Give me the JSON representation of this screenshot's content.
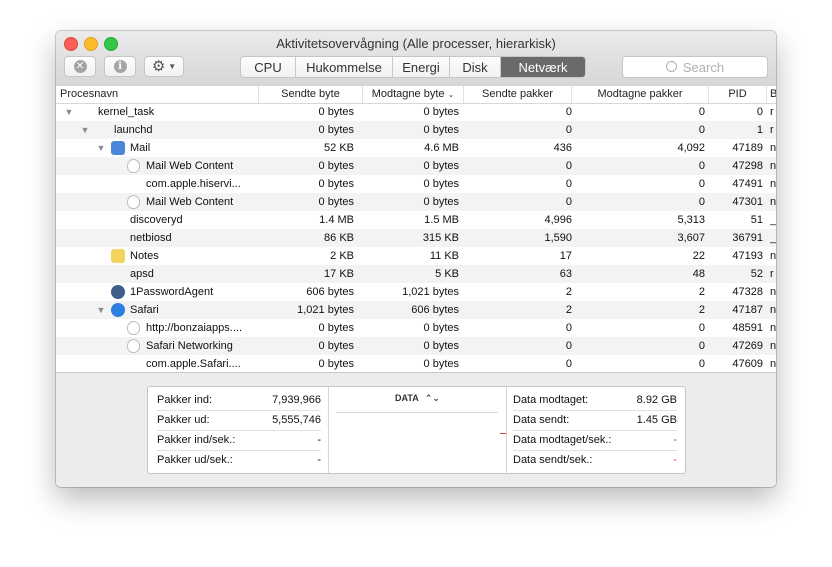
{
  "window": {
    "title": "Aktivitetsovervågning (Alle processer, hierarkisk)"
  },
  "toolbar": {
    "stop_icon": "x-circle-icon",
    "info_icon": "info-icon",
    "gear_icon": "gear-icon",
    "tabs": [
      {
        "label": "CPU",
        "active": false
      },
      {
        "label": "Hukommelse",
        "active": false
      },
      {
        "label": "Energi",
        "active": false
      },
      {
        "label": "Disk",
        "active": false
      },
      {
        "label": "Netværk",
        "active": true
      }
    ],
    "search_placeholder": "Search"
  },
  "table": {
    "columns": [
      "Procesnavn",
      "Sendte byte",
      "Modtagne byte",
      "Sendte pakker",
      "Modtagne pakker",
      "PID",
      "B"
    ],
    "rows": [
      {
        "name": "kernel_task",
        "sent": "0 bytes",
        "recv": "0 bytes",
        "spk": "0",
        "rpk": "0",
        "pid": "0",
        "extra": "r",
        "depth": 0,
        "tri": "open",
        "icon": ""
      },
      {
        "name": "launchd",
        "sent": "0 bytes",
        "recv": "0 bytes",
        "spk": "0",
        "rpk": "0",
        "pid": "1",
        "extra": "r",
        "depth": 1,
        "tri": "open",
        "icon": ""
      },
      {
        "name": "Mail",
        "sent": "52 KB",
        "recv": "4.6 MB",
        "spk": "436",
        "rpk": "4,092",
        "pid": "47189",
        "extra": "n",
        "depth": 2,
        "tri": "open",
        "icon": "mail"
      },
      {
        "name": "Mail Web Content",
        "sent": "0 bytes",
        "recv": "0 bytes",
        "spk": "0",
        "rpk": "0",
        "pid": "47298",
        "extra": "n",
        "depth": 3,
        "tri": "",
        "icon": "shield"
      },
      {
        "name": "com.apple.hiservi...",
        "sent": "0 bytes",
        "recv": "0 bytes",
        "spk": "0",
        "rpk": "0",
        "pid": "47491",
        "extra": "n",
        "depth": 3,
        "tri": "",
        "icon": ""
      },
      {
        "name": "Mail Web Content",
        "sent": "0 bytes",
        "recv": "0 bytes",
        "spk": "0",
        "rpk": "0",
        "pid": "47301",
        "extra": "n",
        "depth": 3,
        "tri": "",
        "icon": "shield"
      },
      {
        "name": "discoveryd",
        "sent": "1.4 MB",
        "recv": "1.5 MB",
        "spk": "4,996",
        "rpk": "5,313",
        "pid": "51",
        "extra": "_",
        "depth": 2,
        "tri": "",
        "icon": ""
      },
      {
        "name": "netbiosd",
        "sent": "86 KB",
        "recv": "315 KB",
        "spk": "1,590",
        "rpk": "3,607",
        "pid": "36791",
        "extra": "_",
        "depth": 2,
        "tri": "",
        "icon": ""
      },
      {
        "name": "Notes",
        "sent": "2 KB",
        "recv": "11 KB",
        "spk": "17",
        "rpk": "22",
        "pid": "47193",
        "extra": "n",
        "depth": 2,
        "tri": "",
        "icon": "notes"
      },
      {
        "name": "apsd",
        "sent": "17 KB",
        "recv": "5 KB",
        "spk": "63",
        "rpk": "48",
        "pid": "52",
        "extra": "r",
        "depth": 2,
        "tri": "",
        "icon": ""
      },
      {
        "name": "1PasswordAgent",
        "sent": "606 bytes",
        "recv": "1,021 bytes",
        "spk": "2",
        "rpk": "2",
        "pid": "47328",
        "extra": "n",
        "depth": 2,
        "tri": "",
        "icon": "1password"
      },
      {
        "name": "Safari",
        "sent": "1,021 bytes",
        "recv": "606 bytes",
        "spk": "2",
        "rpk": "2",
        "pid": "47187",
        "extra": "n",
        "depth": 2,
        "tri": "open",
        "icon": "safari"
      },
      {
        "name": "http://bonzaiapps....",
        "sent": "0 bytes",
        "recv": "0 bytes",
        "spk": "0",
        "rpk": "0",
        "pid": "48591",
        "extra": "n",
        "depth": 3,
        "tri": "",
        "icon": "shield"
      },
      {
        "name": "Safari Networking",
        "sent": "0 bytes",
        "recv": "0 bytes",
        "spk": "0",
        "rpk": "0",
        "pid": "47269",
        "extra": "n",
        "depth": 3,
        "tri": "",
        "icon": "shield"
      },
      {
        "name": "com.apple.Safari....",
        "sent": "0 bytes",
        "recv": "0 bytes",
        "spk": "0",
        "rpk": "0",
        "pid": "47609",
        "extra": "n",
        "depth": 3,
        "tri": "",
        "icon": ""
      }
    ]
  },
  "stats": {
    "left": [
      {
        "label": "Pakker ind:",
        "value": "7,939,966"
      },
      {
        "label": "Pakker ud:",
        "value": "5,555,746"
      },
      {
        "label": "Pakker ind/sek.:",
        "value": "-"
      },
      {
        "label": "Pakker ud/sek.:",
        "value": "-"
      }
    ],
    "center_title": "DATA",
    "right": [
      {
        "label": "Data modtaget:",
        "value": "8.92 GB",
        "color": "#111111"
      },
      {
        "label": "Data sendt:",
        "value": "1.45 GB",
        "color": "#111111"
      },
      {
        "label": "Data modtaget/sek.:",
        "value": "-",
        "color": "#3b66c4"
      },
      {
        "label": "Data sendt/sek.:",
        "value": "-",
        "color": "#d33b3b"
      }
    ]
  }
}
